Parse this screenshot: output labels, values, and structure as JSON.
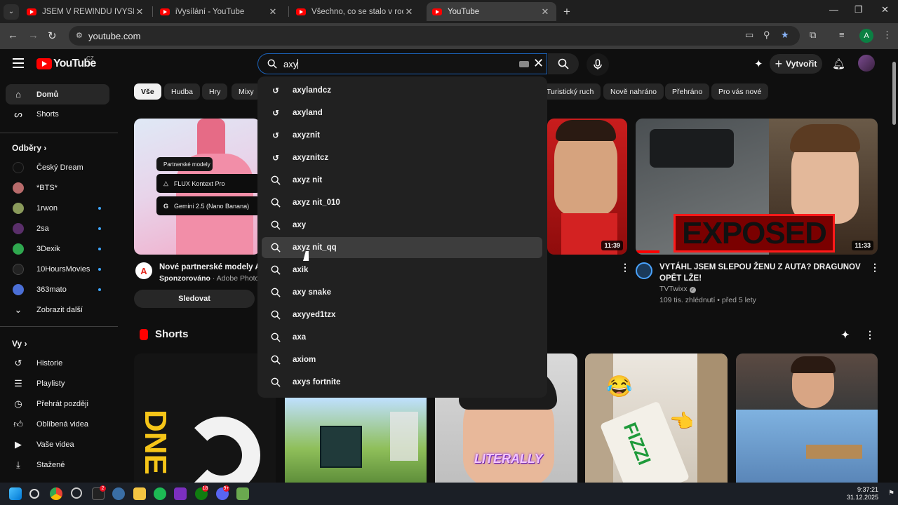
{
  "browser": {
    "tabs": [
      {
        "title": "JSEM V REWINDU IVYSÍLÁNÍ!!! -",
        "active": false
      },
      {
        "title": "iVysílání - YouTube",
        "active": false
      },
      {
        "title": "Všechno, co se stalo v roce 2025",
        "active": false
      },
      {
        "title": "YouTube",
        "active": true
      }
    ],
    "url": "youtube.com",
    "profile_initial": "A"
  },
  "header": {
    "logo_text": "YouTube",
    "country_code": "CZ",
    "search_value": "axy",
    "create_label": "Vytvořit"
  },
  "sidebar": {
    "main": [
      {
        "label": "Domů",
        "icon": "home-icon",
        "active": true
      },
      {
        "label": "Shorts",
        "icon": "shorts-icon",
        "active": false
      }
    ],
    "subscriptions_heading": "Odběry",
    "subscriptions": [
      {
        "label": "Český Dream",
        "color": "#111111",
        "new": false
      },
      {
        "label": "*BTS*",
        "color": "#b86b6b",
        "new": false
      },
      {
        "label": "1rwon",
        "color": "#8a9a5b",
        "new": true
      },
      {
        "label": "2sa",
        "color": "#5a2f6a",
        "new": true
      },
      {
        "label": "3Dexik",
        "color": "#2fa84f",
        "new": true
      },
      {
        "label": "10HoursMovies",
        "color": "#222222",
        "new": true
      },
      {
        "label": "363mato",
        "color": "#4b6fd6",
        "new": true
      }
    ],
    "show_more": "Zobrazit další",
    "you_heading": "Vy",
    "you_items": [
      {
        "label": "Historie",
        "icon": "history-icon"
      },
      {
        "label": "Playlisty",
        "icon": "playlist-icon"
      },
      {
        "label": "Přehrát později",
        "icon": "clock-icon"
      },
      {
        "label": "Oblíbená videa",
        "icon": "thumb-up-icon"
      },
      {
        "label": "Vaše videa",
        "icon": "video-icon"
      },
      {
        "label": "Stažené",
        "icon": "download-icon"
      }
    ]
  },
  "chips": [
    {
      "label": "Vše",
      "active": true
    },
    {
      "label": "Hudba",
      "active": false
    },
    {
      "label": "Hry",
      "active": false
    },
    {
      "label": "Mixy",
      "active": false
    },
    {
      "label": "Turistický ruch",
      "active": false
    },
    {
      "label": "Nově nahráno",
      "active": false
    },
    {
      "label": "Přehráno",
      "active": false
    },
    {
      "label": "Pro vás nové",
      "active": false
    }
  ],
  "search_suggestions": [
    {
      "text": "axylandcz",
      "type": "history"
    },
    {
      "text": "axyland",
      "type": "history"
    },
    {
      "text": "axyznit",
      "type": "history"
    },
    {
      "text": "axyznitcz",
      "type": "history"
    },
    {
      "text": "axyz nit",
      "type": "search"
    },
    {
      "text": "axyz nit_010",
      "type": "search"
    },
    {
      "text": "axy",
      "type": "search"
    },
    {
      "text": "axyz nit_qq",
      "type": "search"
    },
    {
      "text": "axik",
      "type": "search"
    },
    {
      "text": "axy snake",
      "type": "search"
    },
    {
      "text": "axyyed1tzx",
      "type": "search"
    },
    {
      "text": "axa",
      "type": "search"
    },
    {
      "text": "axiom",
      "type": "search"
    },
    {
      "text": "axys fortnite",
      "type": "search"
    }
  ],
  "ad_card": {
    "partner_label": "Partnerské modely",
    "row1": "FLUX Kontext Pro",
    "row2": "Gemini 2.5 (Nano Banana)",
    "title": "Nové partnerské modely AI p",
    "sponsor": "Sponzorováno",
    "advertiser": "· Adobe Photosh",
    "cta": "Sledovat"
  },
  "video_middle": {
    "duration": "11:39"
  },
  "video_right": {
    "duration": "11:33",
    "overlay_text": "EXPOSED",
    "title": "VYTÁHL JSEM SLEPOU ŽENU Z AUTA? DRAGUNOV OPĚT LŽE!",
    "channel": "TVTwixx",
    "meta": "109 tis. zhlédnutí • před 5 lety"
  },
  "shorts": {
    "heading": "Shorts",
    "overlay_texts": [
      "DNE",
      "LITERALLY",
      "FIZZI"
    ]
  },
  "taskbar": {
    "time": "9:37:21",
    "date": "31.12.2025",
    "badges": [
      "2",
      "18",
      "9+"
    ]
  }
}
